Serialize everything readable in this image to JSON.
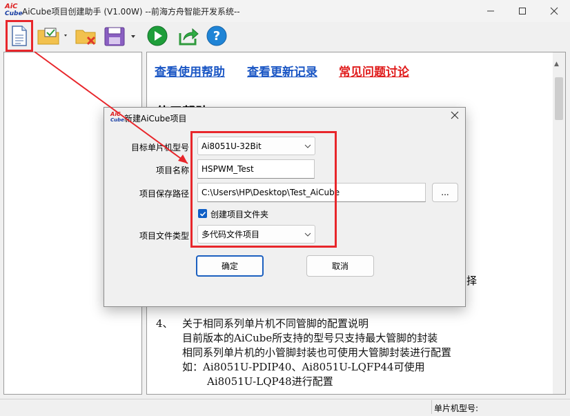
{
  "window": {
    "title": "AiCube项目创建助手 (V1.00W) --前海方舟智能开发系统--",
    "logo_line1": "AiC",
    "logo_line2": "Cube"
  },
  "toolbar": {
    "icons": [
      "new-project-icon",
      "open-project-icon",
      "delete-project-icon",
      "save-icon",
      "run-icon",
      "export-icon",
      "help-icon"
    ]
  },
  "links": {
    "help": "查看使用帮助",
    "updates": "查看更新记录",
    "faq": "常见问题讨论"
  },
  "content": {
    "heading_partial": "使用帮助",
    "item4_num": "4、",
    "item4_title": "关于相同系列单片机不同管脚的配置说明",
    "line1": "目前版本的AiCube所支持的型号只支持最大管脚的封装",
    "line2": "相同系列单片机的小管脚封装也可使用大管脚封装进行配置",
    "line3": "如：Ai8051U-PDIP40、Ai8051U-LQFP44可使用",
    "line4": "Ai8051U-LQP48进行配置",
    "frag_right1": "、",
    "frag_right2": "择"
  },
  "status": {
    "mcu_label": "单片机型号:"
  },
  "dialog": {
    "title": "新建AiCube项目",
    "target_label": "目标单片机型号",
    "target_value": "Ai8051U-32Bit",
    "name_label": "项目名称",
    "name_value": "HSPWM_Test",
    "path_label": "项目保存路径",
    "path_value": "C:\\Users\\HP\\Desktop\\Test_AiCube",
    "browse_label": "...",
    "create_folder_label": "创建项目文件夹",
    "create_folder_checked": true,
    "type_label": "项目文件类型",
    "type_value": "多代码文件项目",
    "ok_label": "确定",
    "cancel_label": "取消"
  },
  "colors": {
    "highlight": "#e8262b",
    "link_blue": "#1a56c4",
    "link_red": "#e01c1c"
  }
}
